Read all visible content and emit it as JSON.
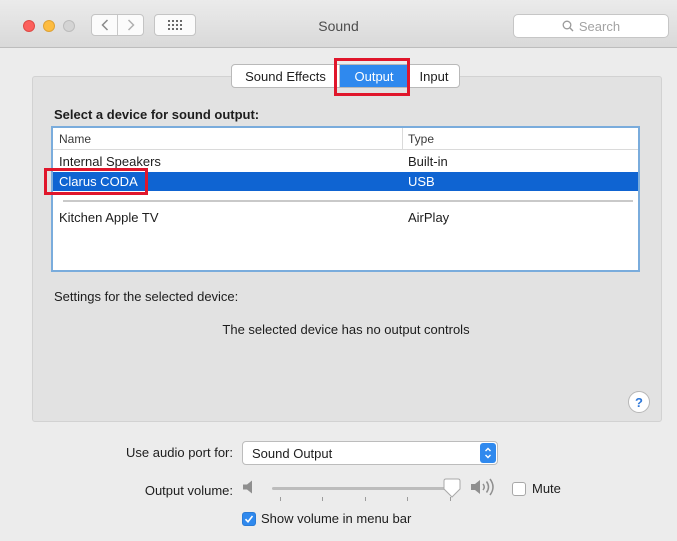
{
  "window": {
    "title": "Sound",
    "search_placeholder": "Search",
    "colors": {
      "accent": "#2f89ee",
      "selection": "#0f64d2",
      "annotation": "#e0162b"
    }
  },
  "tabs": [
    {
      "label": "Sound Effects",
      "selected": false
    },
    {
      "label": "Output",
      "selected": true
    },
    {
      "label": "Input",
      "selected": false
    }
  ],
  "output": {
    "heading": "Select a device for sound output:",
    "columns": {
      "name": "Name",
      "type": "Type"
    },
    "devices": [
      {
        "name": "Internal Speakers",
        "type": "Built-in",
        "selected": false
      },
      {
        "name": "Clarus CODA",
        "type": "USB",
        "selected": true
      },
      {
        "name": "Kitchen Apple TV",
        "type": "AirPlay",
        "selected": false
      }
    ],
    "settings_label": "Settings for the selected device:",
    "no_controls_text": "The selected device has no output controls",
    "help_label": "?"
  },
  "controls": {
    "audio_port_label": "Use audio port for:",
    "audio_port_value": "Sound Output",
    "volume_label": "Output volume:",
    "volume_level": 0.92,
    "mute_label": "Mute",
    "mute_checked": false,
    "show_volume_label": "Show volume in menu bar",
    "show_volume_checked": true
  },
  "icons": [
    "back-chevron-icon",
    "forward-chevron-icon",
    "grid-icon",
    "search-icon",
    "speaker-low-icon",
    "speaker-high-icon",
    "checkmark-icon",
    "popup-arrows-icon",
    "help-icon"
  ]
}
